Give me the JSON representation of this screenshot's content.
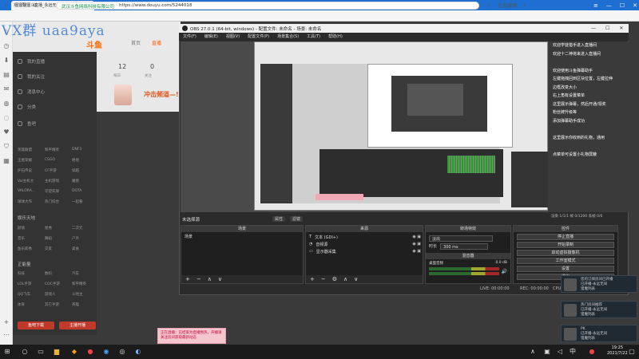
{
  "browser": {
    "tab_title": "狸狸狸狸斗直播_永远无间直播_斗鱼",
    "url_host": "武汉斗鱼网络科技有限公司",
    "url": "https://www.douyu.com/5244018",
    "search_placeholder": "在此搜索"
  },
  "watermark": "VX群 uaa9aya",
  "site": {
    "brand": "斗鱼",
    "nav": [
      "首页",
      "直播"
    ],
    "banner_counts": [
      {
        "num": "12",
        "label": "每日"
      },
      {
        "num": "0",
        "label": "关注"
      }
    ],
    "banner_title": "冲击频道—!",
    "sidebar_items": [
      "我的直播",
      "我的关注",
      "消息中心",
      "分类",
      "鱼吧"
    ],
    "sidebar_grid": [
      [
        "英雄联盟",
        "和平精英",
        "DNF3"
      ],
      [
        "王者荣耀",
        "CSGO",
        "绝地"
      ],
      [
        "炉石传说",
        "CF手游",
        "穿越"
      ],
      [
        "Val主机大",
        "主机游戏",
        "魔兽"
      ],
      [
        "VALORA...",
        "守望先锋",
        "DOTA"
      ],
      [
        "球球大作",
        "热门综合",
        "一起看"
      ]
    ],
    "sidebar_section": "娱乐天地",
    "sidebar_grid2": [
      [
        "颜值",
        "星秀",
        "二次元"
      ],
      [
        "音乐",
        "舞蹈",
        "户外"
      ],
      [
        "鱼乐新秀",
        "交友",
        "美食"
      ]
    ],
    "sidebar_section2": "正能量",
    "sidebar_grid3": [
      [
        "科技",
        "数码",
        "汽车"
      ],
      [
        "LOL手游",
        "COC手游",
        "和平精英"
      ],
      [
        "QQ飞车",
        "游戏人",
        "斗地主"
      ],
      [
        "体育",
        "其它手游",
        "英雄"
      ]
    ],
    "sidebar_buttons": [
      "鱼吧下载",
      "主播开播"
    ],
    "notice": "正在直播：已结束为直播预热，开播请关注房间获取最新动态"
  },
  "obs": {
    "title": "OBS 27.0.1 (64-bit, windows) - 配置文件: 未命名 - 场景: 未命名",
    "menu": [
      "文件(F)",
      "编辑(E)",
      "视图(V)",
      "配置文件(P)",
      "场景集合(S)",
      "工具(T)",
      "帮助(H)"
    ],
    "scene_label": "未选择源",
    "scene_controls": [
      "属性",
      "滤镜"
    ],
    "stats": "渲染 1/1/1  帧 0/1200  丢帧 0/0",
    "docks": {
      "scenes": {
        "title": "场景",
        "items": [
          "场景"
        ]
      },
      "sources": {
        "title": "来源",
        "items": [
          "文本 (GDI+)",
          "音频源",
          "显示器采集"
        ]
      },
      "mixer": {
        "title": "混音器",
        "items": [
          {
            "name": "桌面音频",
            "db": "0.0 dB"
          }
        ]
      },
      "transitions": {
        "title": "转场特效",
        "fade": "淡出",
        "duration_label": "时长",
        "duration": "300 ms"
      },
      "controls": {
        "title": "控件",
        "buttons": [
          "停止直播",
          "开始录制",
          "启动虚拟摄像机",
          "工作室模式",
          "设置",
          "退出"
        ]
      }
    },
    "status": {
      "live": "LIVE: 00:00:00",
      "rec": "REC: 00:00:00",
      "cpu": "CPU: 3.0%, 30.00 fps"
    }
  },
  "chat_overlay": [
    "欢迎学徒猎手进入直播间",
    "欢迎十二神将来进入直播间",
    "",
    "欢迎使用斗鱼弹幕助手",
    "左键拖拽回到区块位置，左键拉伸",
    "边框改变大小",
    "右上角有设置菜单",
    "这里展示弹幕，然后开通/领奖",
    "粉丝牌升级等",
    "添加弹幕助手成功",
    "",
    "这里展示你收到的礼物，通用",
    "",
    "点菜单可设置小礼物屏蔽"
  ],
  "toasts": [
    {
      "title": "您的订阅房间已开播",
      "sub": "已开播-永远无间",
      "tag": "猎魔列表"
    },
    {
      "title": "热门房间推荐",
      "sub": "已开播-永远无间",
      "tag": "猎魔列表"
    },
    {
      "title": "PK",
      "sub": "已开播-永远无间",
      "tag": "猎魔列表"
    }
  ],
  "taskbar": {
    "time": "19:25",
    "date": "2021/7/22"
  }
}
